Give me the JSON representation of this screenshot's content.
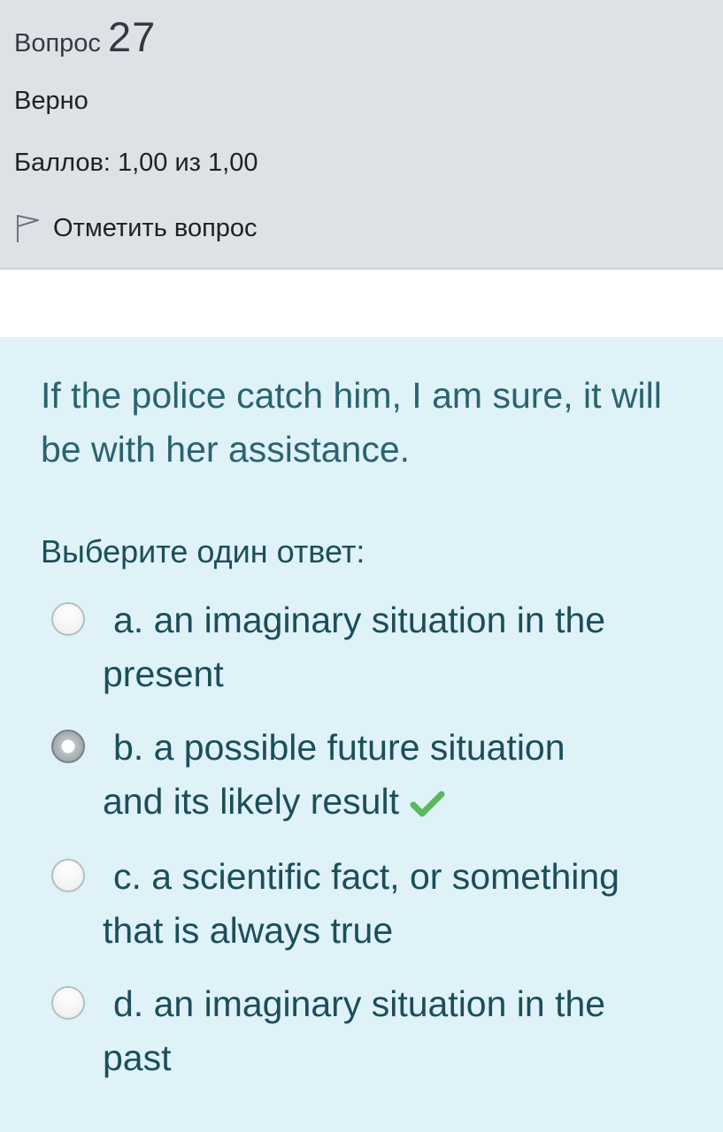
{
  "question_info": {
    "label": "Вопрос",
    "number": "27",
    "state": "Верно",
    "grade": "Баллов: 1,00 из 1,00",
    "flag_label": "Отметить вопрос"
  },
  "question": {
    "text": "If the police catch him, I am sure, it will be with her assistance.",
    "prompt": "Выберите один ответ:"
  },
  "answers": [
    {
      "line1": "a. an imaginary situation in the",
      "line2": "present",
      "selected": false,
      "correct": false
    },
    {
      "line1": "b. a possible future situation",
      "line2": "and its likely result",
      "selected": true,
      "correct": true
    },
    {
      "line1": "c. a scientific fact, or something",
      "line2": "that is always true",
      "selected": false,
      "correct": false
    },
    {
      "line1": "d. an imaginary situation in the",
      "line2": "past",
      "selected": false,
      "correct": false
    }
  ],
  "icons": {
    "flag": "flag-outline-icon",
    "correct": "checkmark-icon"
  },
  "colors": {
    "info_bg": "#dee2e6",
    "content_bg": "#def2f8",
    "text_teal": "#1c4e5a",
    "check_green": "#5cb85c"
  }
}
